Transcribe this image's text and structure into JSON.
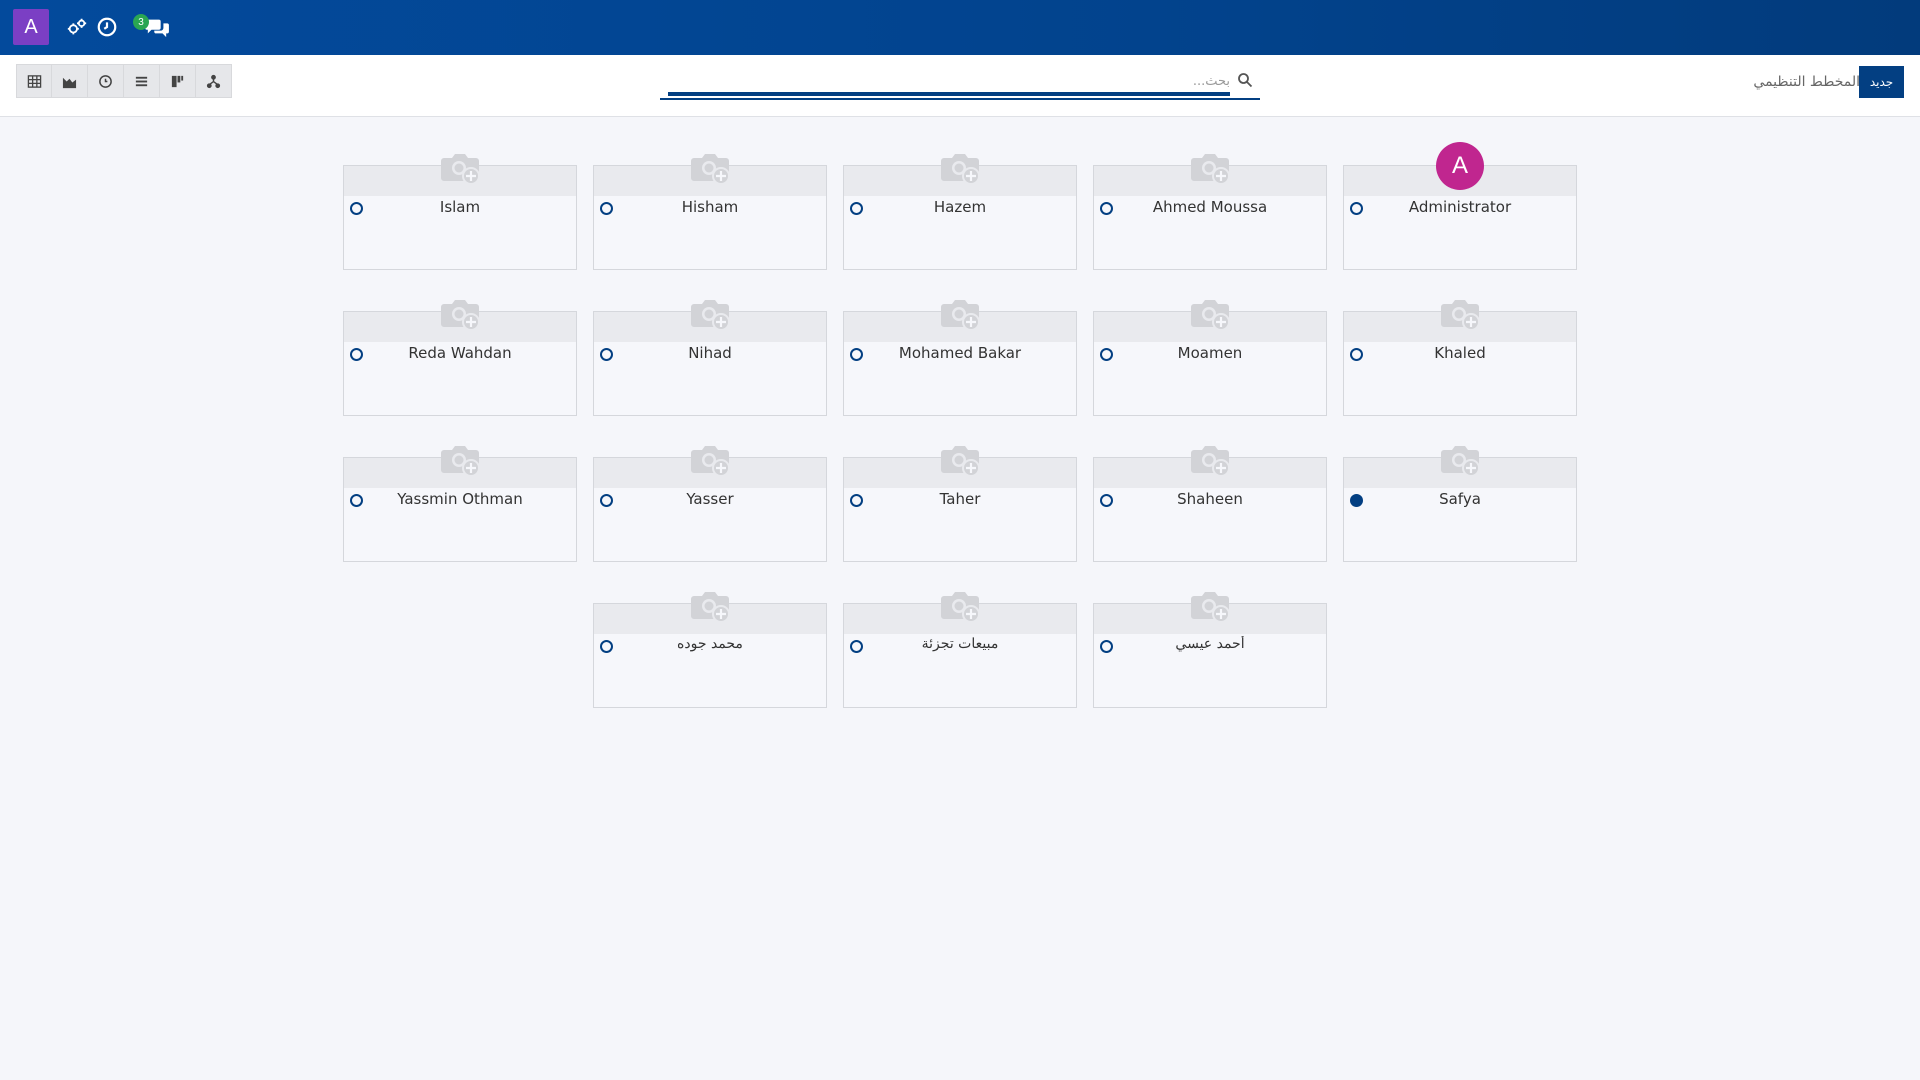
{
  "navbar": {
    "avatar_letter": "A",
    "activity_icon": "gear-users-icon",
    "clock_icon": "clock-icon",
    "chat_icon": "chat-bubbles-icon",
    "chat_badge": "3"
  },
  "control_panel": {
    "breadcrumb": "المخطط التنظيمي",
    "new_label": "جديد",
    "search": {
      "placeholder": "بحث...",
      "value": ""
    },
    "views": [
      {
        "name": "list-view",
        "icon": "table-icon"
      },
      {
        "name": "graph-view",
        "icon": "area-chart-icon"
      },
      {
        "name": "activity-view",
        "icon": "clock-icon"
      },
      {
        "name": "list-lines-view",
        "icon": "list-icon"
      },
      {
        "name": "kanban-view",
        "icon": "kanban-icon"
      },
      {
        "name": "hierarchy-view",
        "icon": "hierarchy-icon"
      }
    ]
  },
  "employees": [
    {
      "name": "Islam",
      "status": "offline",
      "photo": "placeholder"
    },
    {
      "name": "Hisham",
      "status": "offline",
      "photo": "placeholder"
    },
    {
      "name": "Hazem",
      "status": "offline",
      "photo": "placeholder"
    },
    {
      "name": "Ahmed Moussa",
      "status": "offline",
      "photo": "placeholder"
    },
    {
      "name": "Administrator",
      "status": "offline",
      "photo": "avatar",
      "avatar_letter": "A"
    },
    {
      "name": "Reda Wahdan",
      "status": "offline",
      "photo": "placeholder"
    },
    {
      "name": "Nihad",
      "status": "offline",
      "photo": "placeholder"
    },
    {
      "name": "Mohamed Bakar",
      "status": "offline",
      "photo": "placeholder"
    },
    {
      "name": "Moamen",
      "status": "offline",
      "photo": "placeholder"
    },
    {
      "name": "Khaled",
      "status": "offline",
      "photo": "placeholder"
    },
    {
      "name": "Yassmin Othman",
      "status": "offline",
      "photo": "placeholder"
    },
    {
      "name": "Yasser",
      "status": "offline",
      "photo": "placeholder"
    },
    {
      "name": "Taher",
      "status": "offline",
      "photo": "placeholder"
    },
    {
      "name": "Shaheen",
      "status": "offline",
      "photo": "placeholder"
    },
    {
      "name": "Safya",
      "status": "online",
      "photo": "placeholder"
    },
    {
      "name": "محمد جوده",
      "status": "offline",
      "photo": "placeholder"
    },
    {
      "name": "مبيعات تجزئة",
      "status": "offline",
      "photo": "placeholder"
    },
    {
      "name": "أحمد عيسي",
      "status": "offline",
      "photo": "placeholder"
    }
  ],
  "colors": {
    "navbar": "#034a9c",
    "accent": "#033f82",
    "avatar_top": "#7b3fc4",
    "admin_avatar": "#c0268f",
    "badge": "#2aa653"
  }
}
